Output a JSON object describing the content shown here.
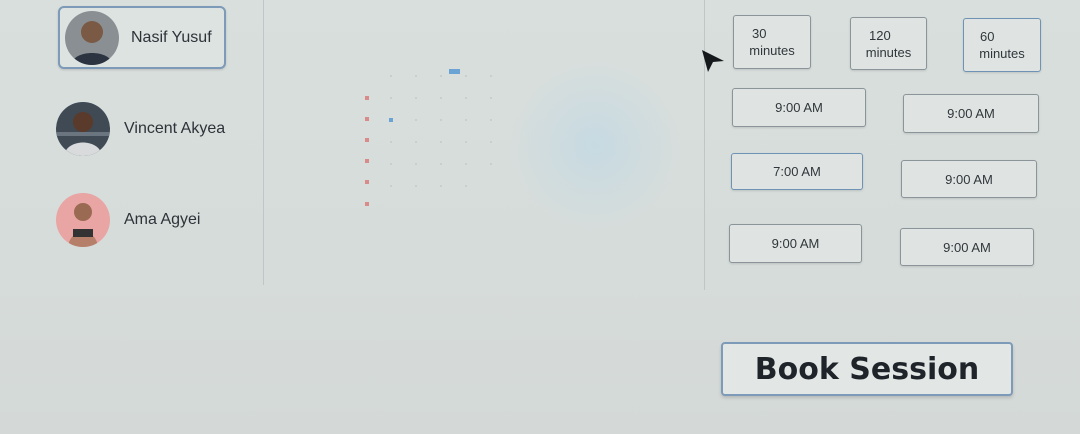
{
  "coaches": [
    {
      "name": "Nasif Yusuf",
      "selected": true,
      "avatar_icon": "avatar-man-dark-shirt"
    },
    {
      "name": "Vincent Akyea",
      "selected": false,
      "avatar_icon": "avatar-man-gym"
    },
    {
      "name": "Ama Agyei",
      "selected": false,
      "avatar_icon": "avatar-woman-pink"
    }
  ],
  "durations": [
    {
      "number": "30",
      "unit": "minutes"
    },
    {
      "number": "120",
      "unit": "minutes"
    },
    {
      "number": "60",
      "unit": "minutes"
    }
  ],
  "time_slots": [
    {
      "label": "9:00 AM"
    },
    {
      "label": "9:00 AM"
    },
    {
      "label": "7:00 AM",
      "selected": true
    },
    {
      "label": "9:00 AM"
    },
    {
      "label": "9:00 AM"
    },
    {
      "label": "9:00 AM"
    }
  ],
  "book_button": {
    "label": "Book Session"
  },
  "colors": {
    "accent_border": "#7d9bb8",
    "calendar_marker": "#d98a8a",
    "calendar_highlight": "#6aa3d4"
  }
}
